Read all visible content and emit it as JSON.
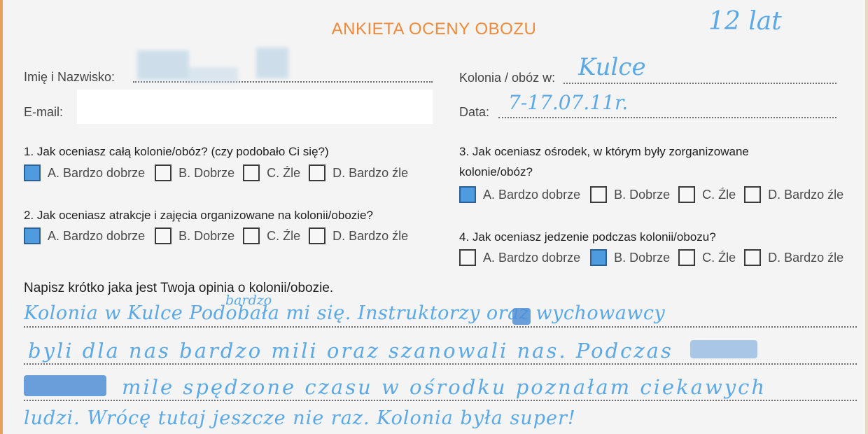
{
  "title": "ANKIETA OCENY OBOZU",
  "age": "12 lat",
  "fields": {
    "name_label": "Imię i Nazwisko:",
    "email_label": "E-mail:",
    "camp_label": "Kolonia / obóz w:",
    "camp_value": "Kulce",
    "date_label": "Data:",
    "date_value": "7-17.07.11r."
  },
  "q1": {
    "text": "1. Jak oceniasz całą kolonie/obóz? (czy podobało Ci się?)",
    "options": [
      "A. Bardzo dobrze",
      "B. Dobrze",
      "C. Źle",
      "D. Bardzo źle"
    ],
    "selected": 0
  },
  "q2": {
    "text": "2.  Jak oceniasz atrakcje i zajęcia organizowane na kolonii/obozie?",
    "options": [
      "A. Bardzo dobrze",
      "B. Dobrze",
      "C. Źle",
      "D. Bardzo źle"
    ],
    "selected": 0
  },
  "q3": {
    "text_line1": "3. Jak oceniasz ośrodek, w którym były zorganizowane",
    "text_line2": "kolonie/obóz?",
    "options": [
      "A. Bardzo dobrze",
      "B. Dobrze",
      "C. Źle",
      "D. Bardzo źle"
    ],
    "selected": 0
  },
  "q4": {
    "text": "4.  Jak oceniasz jedzenie podczas kolonii/obozu?",
    "options": [
      "A. Bardzo dobrze",
      "B. Dobrze",
      "C. Źle",
      "D. Bardzo źle"
    ],
    "selected": 1
  },
  "opinion": {
    "prompt": "Napisz krótko jaka jest Twoja opinia o kolonii/obozie.",
    "insert_word": "bardzo",
    "lines": [
      "Kolonia w Kulce Podobała mi się. Instruktorzy oraz wychowawcy",
      "byli dla nas bardzo mili oraz szanowali nas. Podczas",
      "mile spędzone czasu w ośrodku poznałam ciekawych",
      "ludzi. Wrócę tutaj jeszcze nie raz. Kolonia była super!"
    ]
  },
  "colors": {
    "title": "#ee8a3a",
    "ink": "#5aa9e6",
    "check": "#4f9be0"
  }
}
